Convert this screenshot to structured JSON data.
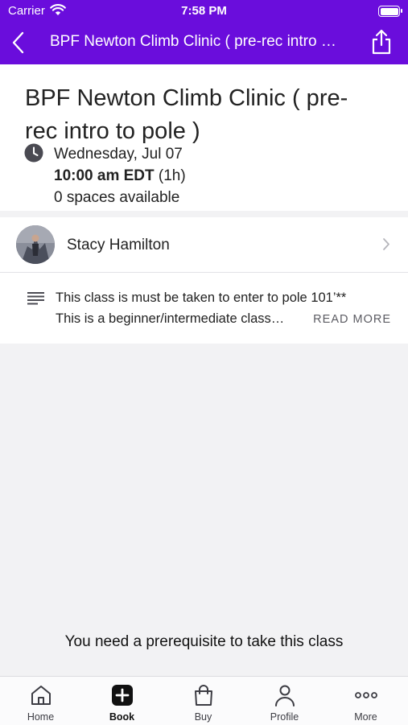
{
  "status_bar": {
    "carrier": "Carrier",
    "time": "7:58 PM"
  },
  "nav": {
    "title": "BPF Newton Climb Clinic ( pre-rec intro to pole )",
    "back_icon": "chevron-left-icon",
    "share_icon": "share-icon"
  },
  "colors": {
    "accent": "#6a0ddc",
    "background": "#f2f2f4"
  },
  "class_info": {
    "title": "BPF Newton Climb Clinic ( pre-rec intro to pole )",
    "date": "Wednesday, Jul 07",
    "time": "10:00 am EDT",
    "duration": "(1h)",
    "spaces": "0 spaces available"
  },
  "instructor": {
    "name": "Stacy Hamilton"
  },
  "description": {
    "line1": "This class is must be taken to enter to pole 101’**",
    "line2": "This is a beginner/intermediate class…",
    "read_more": "READ MORE"
  },
  "footer_message": "You need a prerequisite to take this class",
  "tabs": [
    {
      "label": "Home",
      "icon": "home-icon",
      "active": false
    },
    {
      "label": "Book",
      "icon": "add-box-icon",
      "active": true
    },
    {
      "label": "Buy",
      "icon": "shopping-bag-icon",
      "active": false
    },
    {
      "label": "Profile",
      "icon": "person-icon",
      "active": false
    },
    {
      "label": "More",
      "icon": "more-dots-icon",
      "active": false
    }
  ]
}
